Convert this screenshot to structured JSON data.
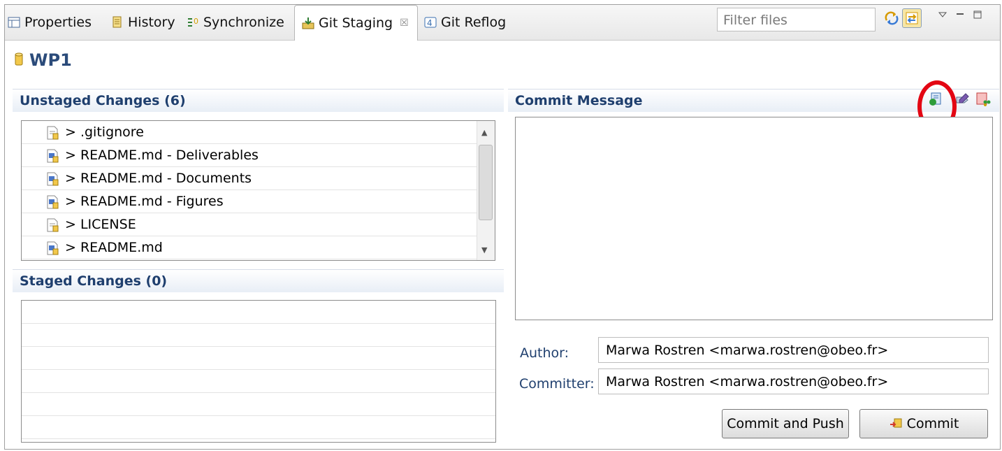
{
  "tabs": {
    "properties": "Properties",
    "history": "History",
    "synchronize": "Synchronize",
    "git_staging": "Git Staging",
    "git_reflog": "Git Reflog",
    "close_glyph": "☒"
  },
  "toolbar": {
    "filter_placeholder": "Filter files",
    "icons": [
      "refresh-icon",
      "link-with-selection-icon",
      "view-menu-icon",
      "minimize-icon",
      "maximize-icon"
    ]
  },
  "repository": {
    "name": "WP1"
  },
  "unstaged": {
    "title": "Unstaged Changes (6)",
    "items": [
      {
        "label": "> .gitignore",
        "icon": "text-file-icon"
      },
      {
        "label": "> README.md - Deliverables",
        "icon": "markdown-file-icon"
      },
      {
        "label": "> README.md - Documents",
        "icon": "markdown-file-icon"
      },
      {
        "label": "> README.md - Figures",
        "icon": "markdown-file-icon"
      },
      {
        "label": "> LICENSE",
        "icon": "text-file-icon"
      },
      {
        "label": "> README.md",
        "icon": "markdown-file-icon"
      }
    ]
  },
  "staged": {
    "title": "Staged Changes (0)",
    "items": []
  },
  "commit": {
    "title": "Commit Message",
    "message": "",
    "author_label": "Author:",
    "author_value": "Marwa Rostren <marwa.rostren@obeo.fr>",
    "committer_label": "Committer:",
    "committer_value": "Marwa Rostren <marwa.rostren@obeo.fr>",
    "commit_and_push": "Commit and Push",
    "commit": "Commit"
  },
  "colors": {
    "accent": "#1f3f6e",
    "highlight_circle": "#e30613"
  }
}
